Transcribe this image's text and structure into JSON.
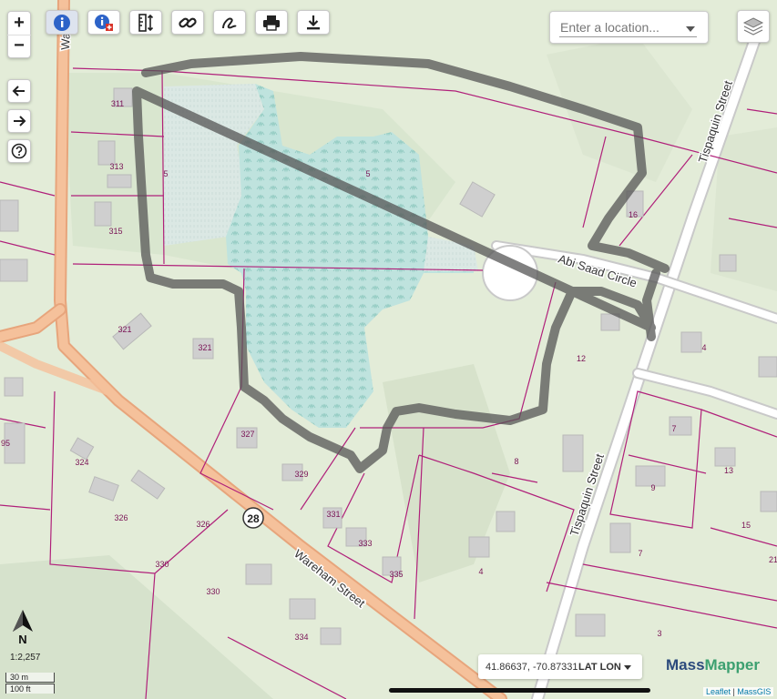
{
  "toolbar": {
    "zoom_in": "+",
    "zoom_out": "−",
    "back_icon": "arrow-left-icon",
    "forward_icon": "arrow-right-icon",
    "help_icon": "question-circle-icon",
    "tools": [
      "info-icon",
      "identify-icon",
      "measure-icon",
      "link-icon",
      "draw-icon",
      "print-icon",
      "download-icon"
    ]
  },
  "search": {
    "placeholder": "Enter a location..."
  },
  "map": {
    "street_labels": [
      "Abi Saad Circle",
      "Tispaquin Street",
      "Tispaquin Street",
      "Wareham Street",
      "Wa"
    ],
    "route_shield": "28",
    "parcel_labels": [
      "311",
      "313",
      "315",
      "5",
      "5",
      "16",
      "321",
      "321",
      "95",
      "327",
      "324",
      "329",
      "326",
      "326",
      "331",
      "333",
      "330",
      "330",
      "335",
      "334",
      "12",
      "8",
      "4",
      "4",
      "7",
      "9",
      "13",
      "15",
      "7",
      "3",
      "21"
    ]
  },
  "north_arrow": "N",
  "scale": {
    "ratio": "1:2,257",
    "metric": "30 m",
    "imperial": "100 ft"
  },
  "coords": {
    "value": "41.86637, -70.87331",
    "mode": "LAT LON"
  },
  "brand": {
    "part1": "Mass",
    "part2": "Mapper"
  },
  "attribution": {
    "leaflet": "Leaflet",
    "sep": " | ",
    "source": "MassGIS"
  },
  "colors": {
    "parcel_line": "#b0207a",
    "road": "#f5b98a",
    "wetland": "#b7dfd9",
    "sketch": "#555555"
  }
}
